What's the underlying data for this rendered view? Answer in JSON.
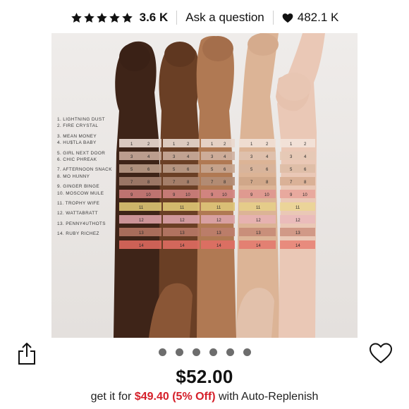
{
  "reviews": {
    "star_count": 5,
    "rating_count": "3.6 K"
  },
  "ask_question_label": "Ask a question",
  "loves": {
    "count": "482.1 K"
  },
  "product_image": {
    "shades": [
      "1. LIGHTNING DUST",
      "2. FIRE CRYSTAL",
      "3. MEAN MONEY",
      "4. HU$TLA BABY",
      "5. GIRL NEXT DOOR",
      "6. CHIC PHREAK",
      "7. AFTERNOON SNACK",
      "8. MO HUNNY",
      "9. GINGER BINGE",
      "10. MOSCOW MULE",
      "11. TROPHY WIFE",
      "12. WATTABRATT",
      "13. PENNY4UTHOTS",
      "14. RUBY RICHEZ"
    ]
  },
  "gallery": {
    "total_images": 6
  },
  "price": "$52.00",
  "auto_replenish": {
    "prefix": "get it for",
    "sale_text": "$49.40 (5% Off)",
    "suffix": "with Auto-Replenish"
  },
  "colors": {
    "sale": "#d5202a",
    "dot": "#6d6d6d",
    "image_bg": "#ebe8e6"
  },
  "icons": {
    "share": "share-icon",
    "wishlist": "heart-outline-icon",
    "loves": "heart-filled-icon",
    "rating": "star-icon"
  }
}
